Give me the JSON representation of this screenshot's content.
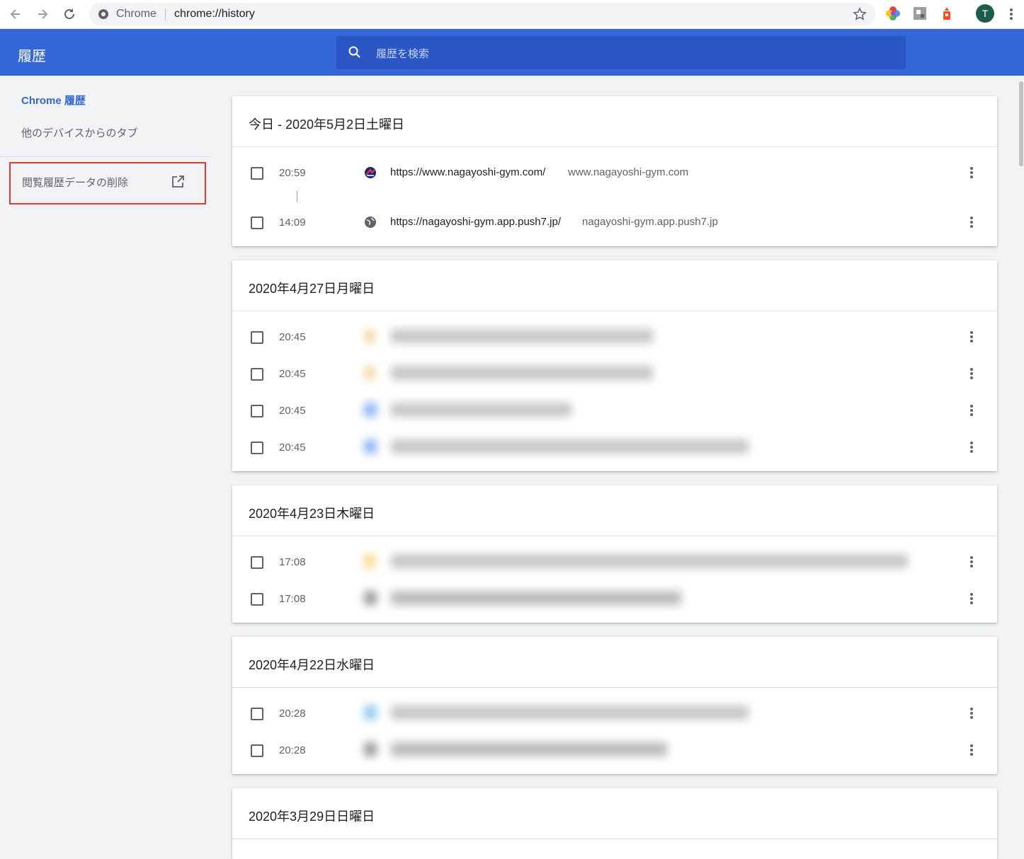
{
  "browser": {
    "site_label": "Chrome",
    "url": "chrome://history",
    "avatar_letter": "T"
  },
  "header": {
    "title": "履歴",
    "search_placeholder": "履歴を検索"
  },
  "sidebar": {
    "active_item": "Chrome 履歴",
    "other_devices": "他のデバイスからのタブ",
    "clear_data": "閲覧履歴データの削除"
  },
  "colors": {
    "header_bg": "#3367d6",
    "search_bg": "#2a56c6",
    "accent": "#3367d6",
    "highlight_border": "#e53935"
  },
  "days": [
    {
      "title": "今日 - 2020年5月2日土曜日",
      "entries": [
        {
          "time": "20:59",
          "title": "https://www.nagayoshi-gym.com/",
          "domain": "www.nagayoshi-gym.com",
          "icon": "gym-logo-icon"
        },
        {
          "time": "14:09",
          "title": "https://nagayoshi-gym.app.push7.jp/",
          "domain": "nagayoshi-gym.app.push7.jp",
          "icon": "globe-icon"
        }
      ]
    },
    {
      "title": "2020年4月27日月曜日",
      "entries": [
        {
          "time": "20:45",
          "blurred": true
        },
        {
          "time": "20:45",
          "blurred": true
        },
        {
          "time": "20:45",
          "blurred": true
        },
        {
          "time": "20:45",
          "blurred": true
        }
      ]
    },
    {
      "title": "2020年4月23日木曜日",
      "entries": [
        {
          "time": "17:08",
          "blurred": true
        },
        {
          "time": "17:08",
          "blurred": true
        }
      ]
    },
    {
      "title": "2020年4月22日水曜日",
      "entries": [
        {
          "time": "20:28",
          "blurred": true
        },
        {
          "time": "20:28",
          "blurred": true
        }
      ]
    },
    {
      "title": "2020年3月29日日曜日",
      "entries": []
    }
  ]
}
